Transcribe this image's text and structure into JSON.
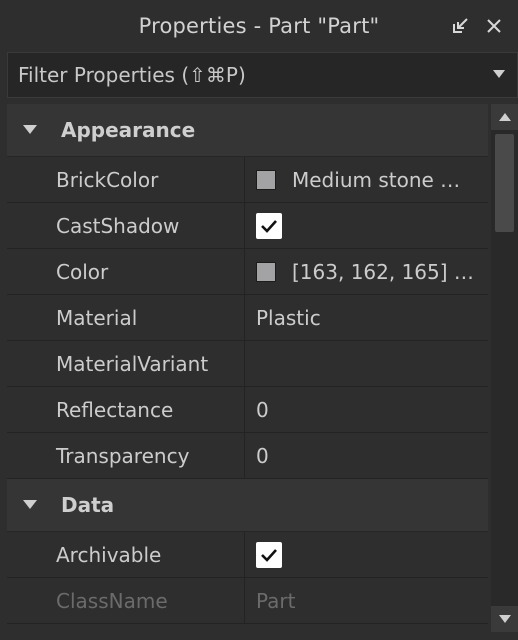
{
  "window": {
    "title": "Properties - Part \"Part\"",
    "icons": [
      "undock-icon",
      "close-icon"
    ]
  },
  "filter": {
    "placeholder": "Filter Properties (⇧⌘P)"
  },
  "sections": [
    {
      "label": "Appearance",
      "rows": [
        {
          "name": "BrickColor",
          "value": "Medium stone …",
          "swatch": "#a3a2a5"
        },
        {
          "name": "CastShadow",
          "checked": true
        },
        {
          "name": "Color",
          "value": "[163, 162, 165] …",
          "swatch": "#a3a2a5"
        },
        {
          "name": "Material",
          "value": "Plastic"
        },
        {
          "name": "MaterialVariant",
          "value": ""
        },
        {
          "name": "Reflectance",
          "value": "0"
        },
        {
          "name": "Transparency",
          "value": "0"
        }
      ]
    },
    {
      "label": "Data",
      "rows": [
        {
          "name": "Archivable",
          "checked": true
        },
        {
          "name": "ClassName",
          "value": "Part",
          "readonly": true
        }
      ]
    }
  ],
  "colors": {
    "background": "#2e2e2e",
    "section_header": "#353535",
    "text": "#cccccc",
    "readonly_text": "#6b6b6b"
  }
}
